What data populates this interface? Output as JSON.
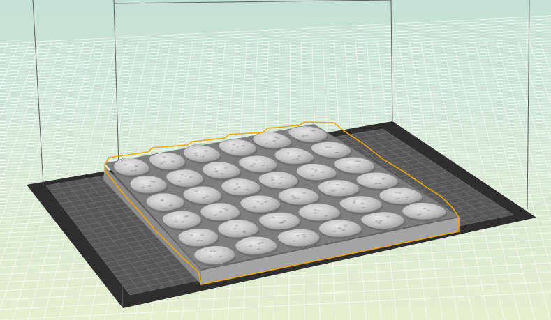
{
  "viewport": {
    "background_top": "#c5e1d7",
    "background_bottom": "#e4efcf",
    "grid_color": "#ffffff"
  },
  "build_plate": {
    "frame_color": "#2f2f2f",
    "surface_color": "#585858",
    "grid_color": "#7a7a7a"
  },
  "build_volume": {
    "line_color": "#5a5a5a"
  },
  "model": {
    "name": "cobblestone-tile",
    "rows": 6,
    "cols": 6,
    "selected": true,
    "selection_color": "#f0a800",
    "base_side_color": "#9d9d9d",
    "base_top_color": "#8a8a8a",
    "stone_color": "#c4c4c4",
    "stone_highlight": "#e2e2e2",
    "stone_shadow": "#6f6f6f"
  }
}
